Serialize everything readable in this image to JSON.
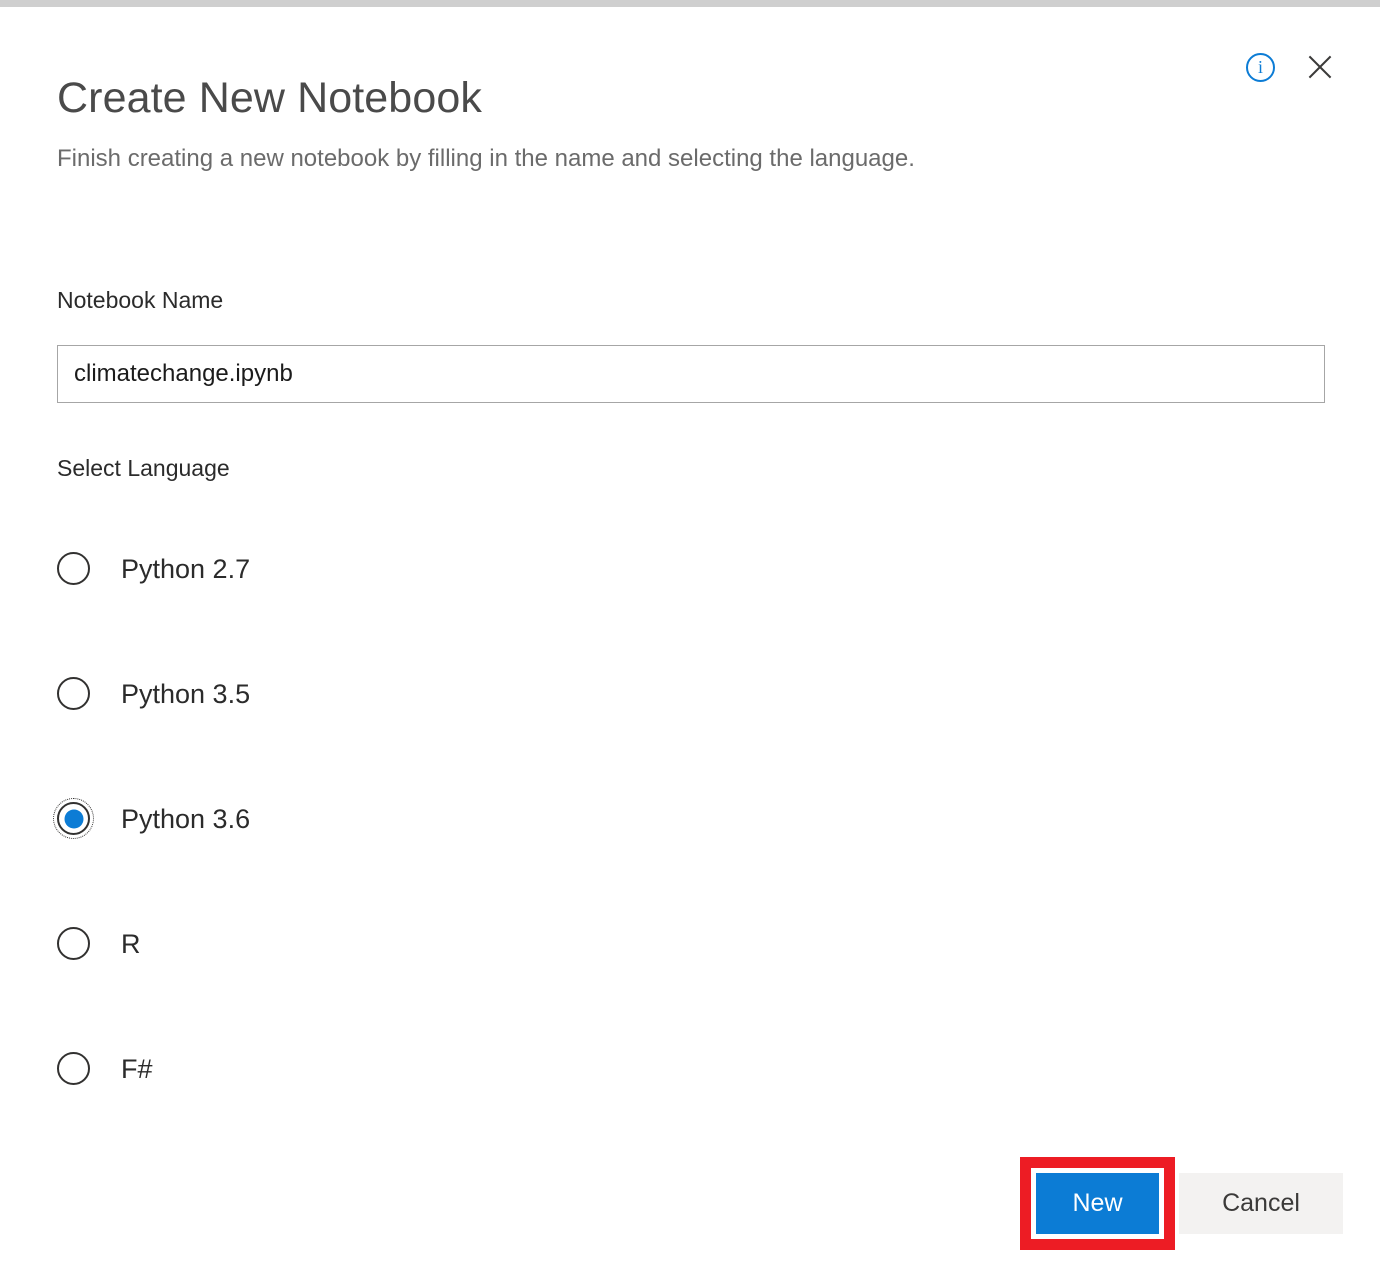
{
  "dialog": {
    "title": "Create New Notebook",
    "subtitle": "Finish creating a new notebook by filling in the name and selecting the language.",
    "info_icon": "info-icon",
    "info_glyph": "i",
    "close_icon": "close-icon"
  },
  "form": {
    "name_label": "Notebook Name",
    "name_value": "climatechange.ipynb",
    "name_placeholder": "Notebook Name",
    "language_label": "Select Language",
    "languages": [
      {
        "label": "Python 2.7",
        "selected": false
      },
      {
        "label": "Python 3.5",
        "selected": false
      },
      {
        "label": "Python 3.6",
        "selected": true
      },
      {
        "label": "R",
        "selected": false
      },
      {
        "label": "F#",
        "selected": false
      }
    ]
  },
  "footer": {
    "new_label": "New",
    "cancel_label": "Cancel"
  },
  "colors": {
    "accent_blue": "#0c7cd5",
    "highlight_red": "#ed1c24",
    "cancel_bg": "#f3f2f1",
    "title_gray": "#4a4a4a",
    "subtitle_gray": "#6b6b6b",
    "input_border": "#a6a6a6",
    "top_strip": "#cfcfcf"
  }
}
